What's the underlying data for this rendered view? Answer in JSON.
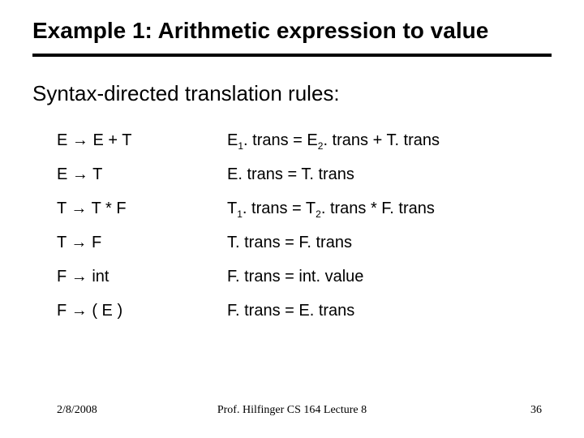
{
  "title": "Example 1: Arithmetic expression to value",
  "subtitle": "Syntax-directed translation rules:",
  "arrow": "→",
  "rules": [
    {
      "prod": {
        "lhs": "E",
        "rhs": "E + T"
      },
      "action_parts": [
        "E",
        "1",
        ". trans = E",
        "2",
        ". trans + T. trans"
      ]
    },
    {
      "prod": {
        "lhs": "E",
        "rhs": "T"
      },
      "action_parts": [
        "E. trans = T. trans"
      ]
    },
    {
      "prod": {
        "lhs": "T",
        "rhs": "T * F"
      },
      "action_parts": [
        "T",
        "1",
        ". trans = T",
        "2",
        ". trans * F. trans"
      ]
    },
    {
      "prod": {
        "lhs": "T",
        "rhs": "F"
      },
      "action_parts": [
        "T. trans = F. trans"
      ]
    },
    {
      "prod": {
        "lhs": "F",
        "rhs": "int"
      },
      "action_parts": [
        "F. trans = int. value"
      ]
    },
    {
      "prod": {
        "lhs": "F",
        "rhs": "( E )"
      },
      "action_parts": [
        "F. trans = E. trans"
      ]
    }
  ],
  "footer": {
    "date": "2/8/2008",
    "center": "Prof. Hilfinger CS 164 Lecture 8",
    "page": "36"
  }
}
